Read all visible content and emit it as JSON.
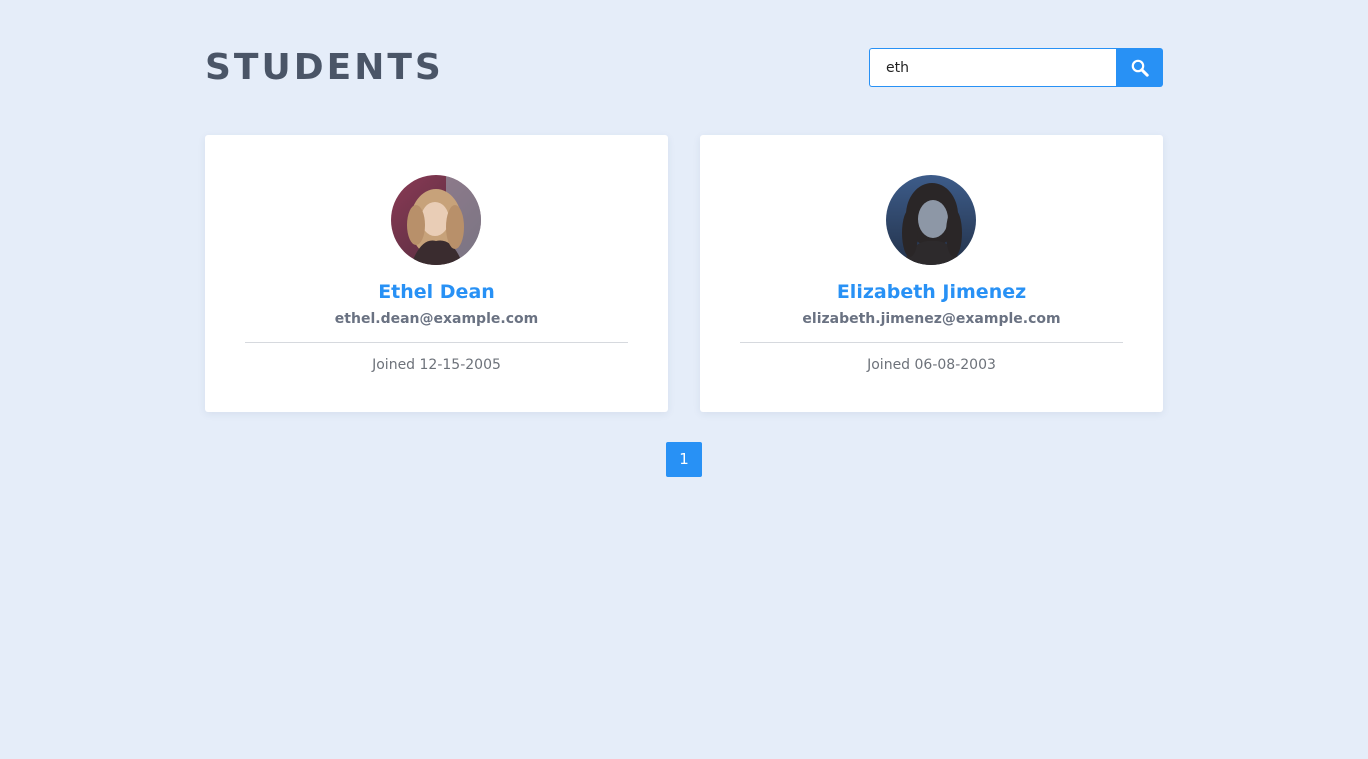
{
  "header": {
    "title": "STUDENTS"
  },
  "search": {
    "value": "eth",
    "button_icon": "search-icon"
  },
  "students": [
    {
      "name": "Ethel Dean",
      "email": "ethel.dean@example.com",
      "joined": "Joined 12-15-2005",
      "avatar": "avatar-photo"
    },
    {
      "name": "Elizabeth Jimenez",
      "email": "elizabeth.jimenez@example.com",
      "joined": "Joined 06-08-2003",
      "avatar": "avatar-photo"
    }
  ],
  "pagination": {
    "pages": [
      "1"
    ],
    "current": "1"
  },
  "colors": {
    "background": "#e5edf9",
    "accent": "#2891f5",
    "title": "#4a5567",
    "card": "#ffffff"
  }
}
